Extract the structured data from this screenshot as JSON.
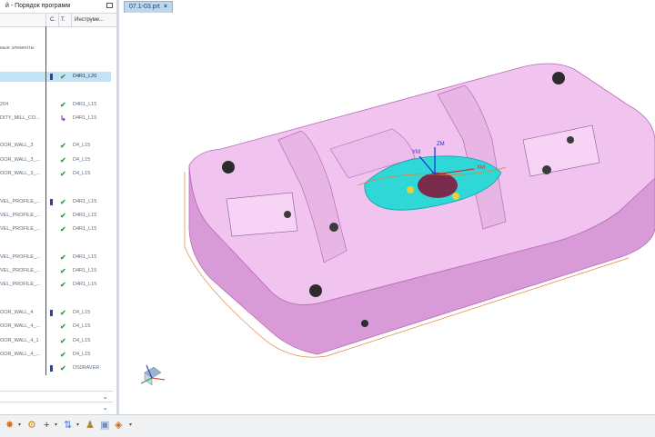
{
  "navigator": {
    "title": "й - Порядок программ",
    "columns": [
      "С.",
      "Т.",
      "Инструме..."
    ],
    "rows": [
      {
        "name": "",
        "flag": false,
        "status": "",
        "tool": ""
      },
      {
        "name": "мые элементы",
        "flag": false,
        "status": "",
        "tool": ""
      },
      {
        "name": "",
        "flag": false,
        "status": "",
        "tool": ""
      },
      {
        "name": "",
        "flag": true,
        "status": "ok",
        "tool": "D4R1_L20",
        "selected": true
      },
      {
        "name": "",
        "flag": false,
        "status": "",
        "tool": ""
      },
      {
        "name": "204",
        "flag": false,
        "status": "ok",
        "tool": "D4R1_L15"
      },
      {
        "name": "DITY_MILL_CO...",
        "flag": false,
        "status": "move",
        "tool": "D4R1_L15"
      },
      {
        "name": "",
        "flag": false,
        "status": "",
        "tool": ""
      },
      {
        "name": "OOR_WALL_3",
        "flag": false,
        "status": "ok",
        "tool": "D4_L15"
      },
      {
        "name": "OOR_WALL_3_...",
        "flag": false,
        "status": "ok",
        "tool": "D4_L15"
      },
      {
        "name": "OOR_WALL_3_...",
        "flag": false,
        "status": "ok",
        "tool": "D4_L15"
      },
      {
        "name": "",
        "flag": false,
        "status": "",
        "tool": ""
      },
      {
        "name": "VEL_PROFILE_...",
        "flag": true,
        "status": "ok",
        "tool": "D4R1_L15"
      },
      {
        "name": "VEL_PROFILE_...",
        "flag": false,
        "status": "ok",
        "tool": "D4R1_L15"
      },
      {
        "name": "VEL_PROFILE_...",
        "flag": false,
        "status": "ok",
        "tool": "D4R1_L15"
      },
      {
        "name": "",
        "flag": false,
        "status": "",
        "tool": ""
      },
      {
        "name": "VEL_PROFILE_...",
        "flag": false,
        "status": "ok",
        "tool": "D4R1_L15"
      },
      {
        "name": "VEL_PROFILE_...",
        "flag": false,
        "status": "ok",
        "tool": "D4R1_L15"
      },
      {
        "name": "VEL_PROFILE_...",
        "flag": false,
        "status": "ok",
        "tool": "D4R1_L15"
      },
      {
        "name": "",
        "flag": false,
        "status": "",
        "tool": ""
      },
      {
        "name": "OOR_WALL_4",
        "flag": true,
        "status": "ok",
        "tool": "D4_L15"
      },
      {
        "name": "OOR_WALL_4_...",
        "flag": false,
        "status": "ok",
        "tool": "D4_L15"
      },
      {
        "name": "OOR_WALL_4_1",
        "flag": false,
        "status": "ok",
        "tool": "D4_L15"
      },
      {
        "name": "OOR_WALL_4_...",
        "flag": false,
        "status": "ok",
        "tool": "D4_L15"
      },
      {
        "name": "",
        "flag": true,
        "status": "ok",
        "tool": "DS0RAVER"
      }
    ]
  },
  "tab": {
    "label": "07.1-03.prt",
    "close": "×"
  },
  "viewport": {
    "axis_labels": {
      "ym": "YM",
      "zm": "ZM",
      "xm": "XM"
    },
    "colors": {
      "part_top": "#f1c4f0",
      "part_side": "#d99bd7",
      "part_edge": "#b86bb8",
      "highlight": "#e3833a",
      "cyan": "#2fd7d7"
    }
  },
  "toolbar": {
    "icons": [
      "feature-icon",
      "gear-icon",
      "connect-icon",
      "add-icon",
      "tool-path-icon",
      "person-icon",
      "box-icon",
      "cube-icon"
    ]
  }
}
